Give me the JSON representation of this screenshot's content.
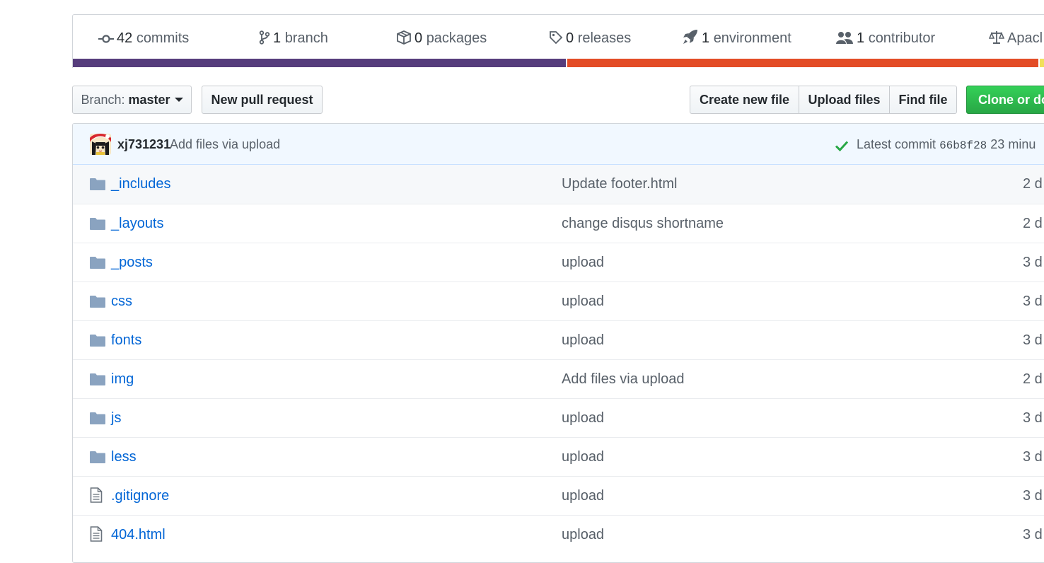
{
  "stats": {
    "commits": {
      "count": "42",
      "label": "commits",
      "icon": "commit-icon"
    },
    "branches": {
      "count": "1",
      "label": "branch",
      "icon": "branch-icon"
    },
    "packages": {
      "count": "0",
      "label": "packages",
      "icon": "package-icon"
    },
    "releases": {
      "count": "0",
      "label": "releases",
      "icon": "tag-icon"
    },
    "environments": {
      "count": "1",
      "label": "environment",
      "icon": "rocket-icon"
    },
    "contributors": {
      "count": "1",
      "label": "contributor",
      "icon": "people-icon"
    },
    "license": {
      "label": "Apacl",
      "icon": "law-icon"
    }
  },
  "language_bar": {
    "colors": [
      "#563d7c",
      "#e34c26",
      "#f1e05a"
    ]
  },
  "toolbar": {
    "branch_prefix": "Branch:",
    "branch_name": "master",
    "new_pull_request": "New pull request",
    "create_new_file": "Create new file",
    "upload_files": "Upload files",
    "find_file": "Find file",
    "clone_or_download": "Clone or do"
  },
  "latest_commit": {
    "author": "xj731231",
    "message": "Add files via upload",
    "label": "Latest commit",
    "sha": "66b8f28",
    "age": "23 minu"
  },
  "files": [
    {
      "type": "dir",
      "name": "_includes",
      "message": "Update footer.html",
      "age": "2 d"
    },
    {
      "type": "dir",
      "name": "_layouts",
      "message": "change disqus shortname",
      "age": "2 d"
    },
    {
      "type": "dir",
      "name": "_posts",
      "message": "upload",
      "age": "3 d"
    },
    {
      "type": "dir",
      "name": "css",
      "message": "upload",
      "age": "3 d"
    },
    {
      "type": "dir",
      "name": "fonts",
      "message": "upload",
      "age": "3 d"
    },
    {
      "type": "dir",
      "name": "img",
      "message": "Add files via upload",
      "age": "2 d"
    },
    {
      "type": "dir",
      "name": "js",
      "message": "upload",
      "age": "3 d"
    },
    {
      "type": "dir",
      "name": "less",
      "message": "upload",
      "age": "3 d"
    },
    {
      "type": "file",
      "name": ".gitignore",
      "message": "upload",
      "age": "3 d"
    },
    {
      "type": "file",
      "name": "404.html",
      "message": "upload",
      "age": "3 d"
    }
  ]
}
